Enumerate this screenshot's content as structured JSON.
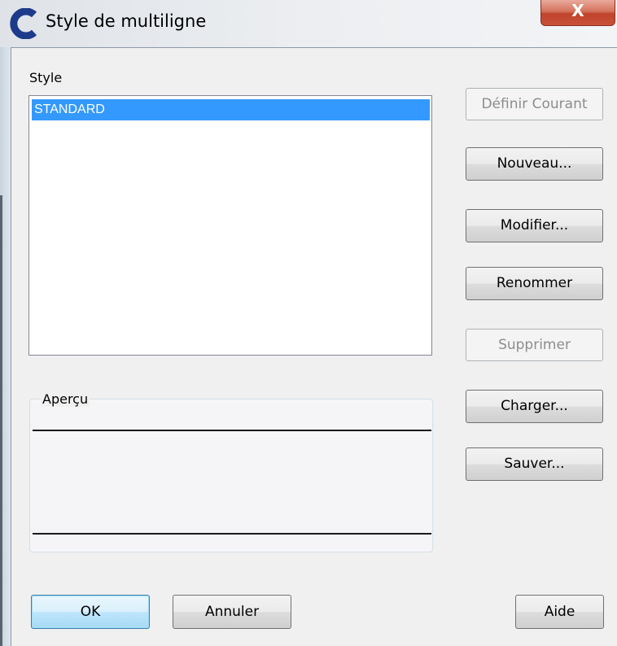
{
  "window": {
    "title": "Style de multiligne",
    "close_label": "X"
  },
  "style_list": {
    "label": "Style",
    "items": [
      "STANDARD"
    ],
    "selected_index": 0
  },
  "preview": {
    "legend": "Aperçu"
  },
  "side_buttons": {
    "set_current": "Définir Courant",
    "new": "Nouveau...",
    "modify": "Modifier...",
    "rename": "Renommer",
    "delete": "Supprimer",
    "load": "Charger...",
    "save": "Sauver..."
  },
  "footer_buttons": {
    "ok": "OK",
    "cancel": "Annuler",
    "help": "Aide"
  },
  "colors": {
    "selection": "#3399ff",
    "app_icon": "#1e3a8a"
  }
}
